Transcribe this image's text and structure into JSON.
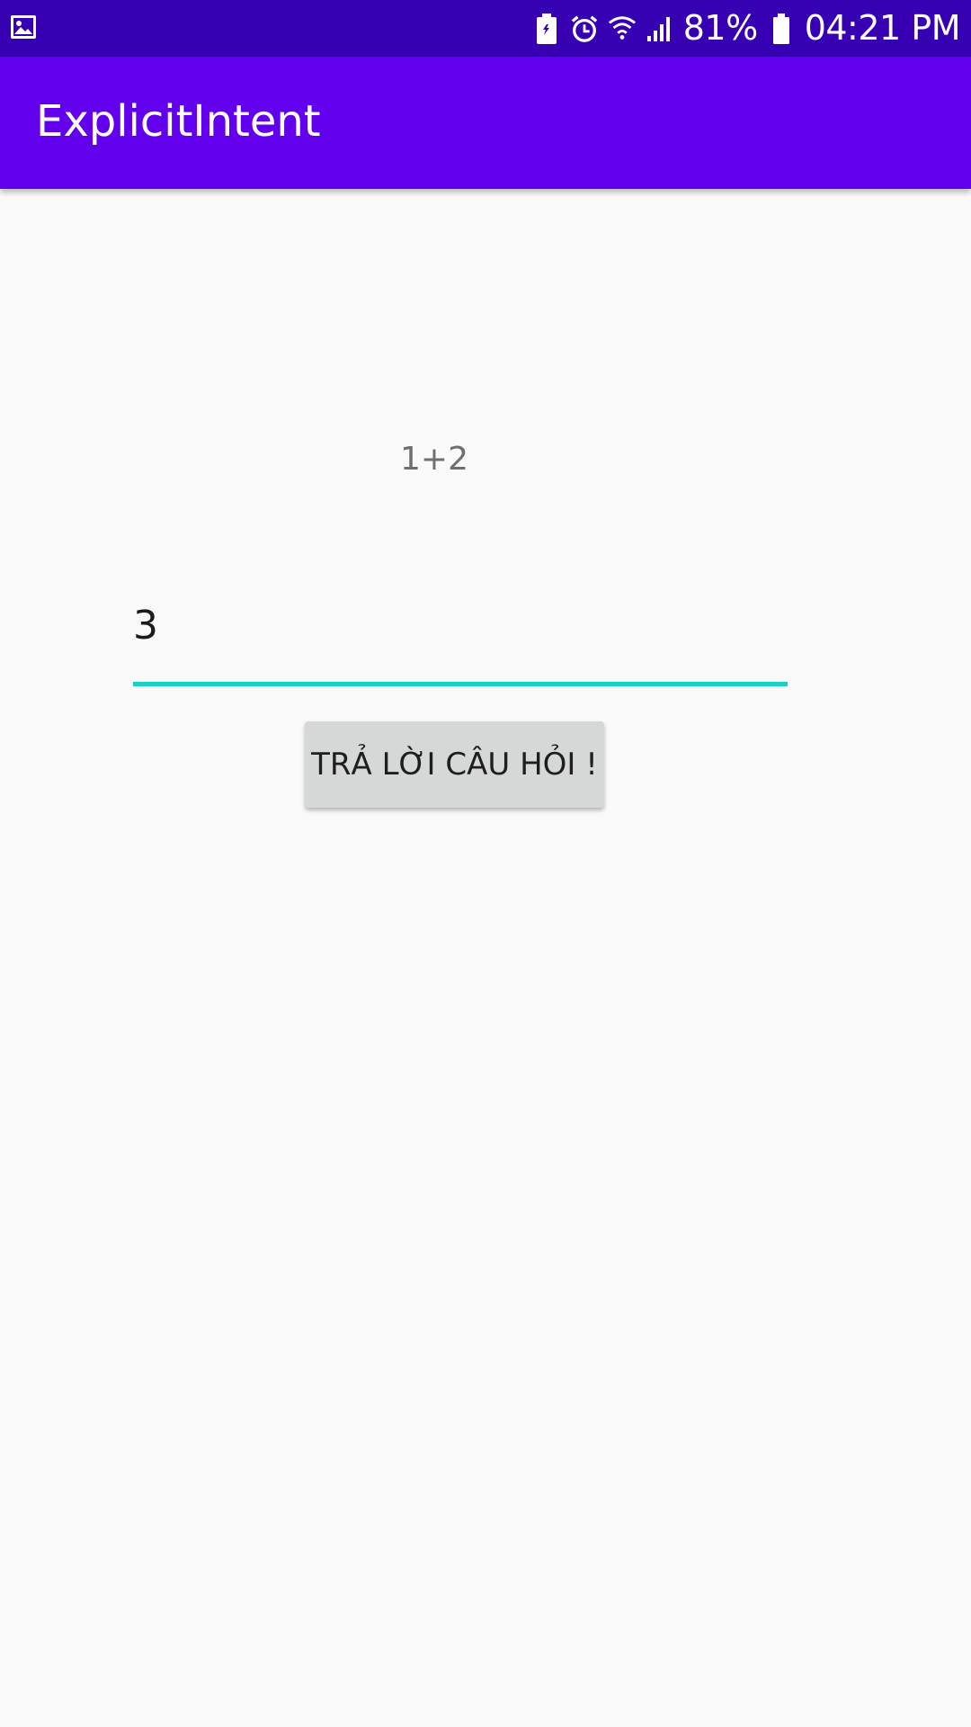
{
  "status_bar": {
    "battery_percent": "81%",
    "time": "04:21 PM",
    "icons": [
      "image-icon",
      "battery-saver-icon",
      "alarm-icon",
      "wifi-icon",
      "signal-icon",
      "battery-icon"
    ]
  },
  "app_bar": {
    "title": "ExplicitIntent"
  },
  "main": {
    "question": "1+2",
    "answer_value": "3",
    "submit_label": "TRẢ LỜI CÂU HỎI !"
  },
  "colors": {
    "status_bar": "#3700b3",
    "app_bar": "#6200ee",
    "accent_underline": "#1ad0c4",
    "button_bg": "#d6d7d7",
    "background": "#fafafa"
  }
}
